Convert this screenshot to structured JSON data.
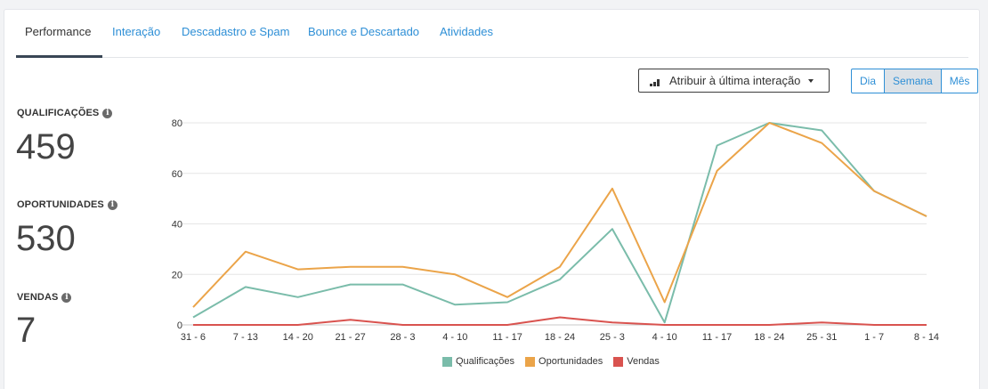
{
  "tabs": [
    {
      "label": "Performance",
      "active": true
    },
    {
      "label": "Interação",
      "active": false
    },
    {
      "label": "Descadastro e Spam",
      "active": false
    },
    {
      "label": "Bounce e Descartado",
      "active": false
    },
    {
      "label": "Atividades",
      "active": false
    }
  ],
  "attribution_dropdown": {
    "label": "Atribuir à última interação",
    "icon": "bar-chart-icon"
  },
  "period_toggle": {
    "options": [
      "Dia",
      "Semana",
      "Mês"
    ],
    "selected": "Semana"
  },
  "metrics": [
    {
      "label": "QUALIFICAÇÕES",
      "value": "459"
    },
    {
      "label": "OPORTUNIDADES",
      "value": "530"
    },
    {
      "label": "VENDAS",
      "value": "7"
    }
  ],
  "info_glyph": "i",
  "chart_data": {
    "type": "line",
    "categories": [
      "31 - 6",
      "7 - 13",
      "14 - 20",
      "21 - 27",
      "28 - 3",
      "4 - 10",
      "11 - 17",
      "18 - 24",
      "25 - 3",
      "4 - 10",
      "11 - 17",
      "18 - 24",
      "25 - 31",
      "1 - 7",
      "8 - 14"
    ],
    "ylim": [
      0,
      80
    ],
    "yticks": [
      0,
      20,
      40,
      60,
      80
    ],
    "grid": true,
    "legend_position": "bottom",
    "series": [
      {
        "name": "Qualificações",
        "color": "#7abcaa",
        "values": [
          3,
          15,
          11,
          16,
          16,
          8,
          9,
          18,
          38,
          1,
          71,
          80,
          77,
          53,
          43
        ]
      },
      {
        "name": "Oportunidades",
        "color": "#eba449",
        "values": [
          7,
          29,
          22,
          23,
          23,
          20,
          11,
          23,
          54,
          9,
          61,
          80,
          72,
          53,
          43
        ]
      },
      {
        "name": "Vendas",
        "color": "#d9534f",
        "values": [
          0,
          0,
          0,
          2,
          0,
          0,
          0,
          3,
          1,
          0,
          0,
          0,
          1,
          0,
          0
        ]
      }
    ]
  }
}
